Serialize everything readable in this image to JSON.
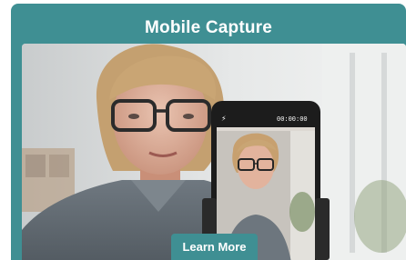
{
  "card": {
    "title": "Mobile Capture",
    "learn_more_label": "Learn More",
    "accent_color": "#3f8f93"
  },
  "phone": {
    "timer": "00:00:00",
    "flash_icon": "flash-off-icon"
  }
}
